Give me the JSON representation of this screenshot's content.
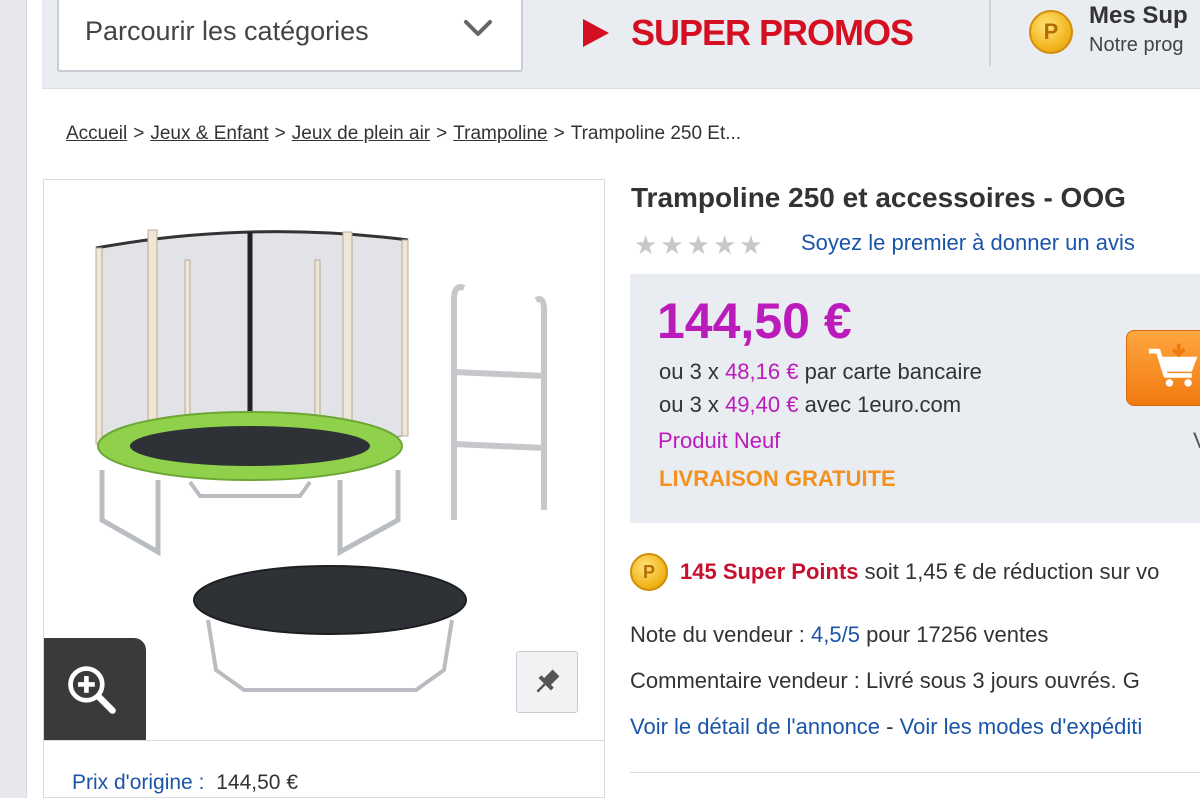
{
  "header": {
    "category_select": "Parcourir les catégories",
    "promo": "SUPER PROMOS",
    "coin_letter": "P",
    "mes_sup": "Mes Sup",
    "notre": "Notre prog"
  },
  "breadcrumb": {
    "items": [
      "Accueil",
      "Jeux & Enfant",
      "Jeux de plein air",
      "Trampoline"
    ],
    "current": "Trampoline 250 Et...",
    "separator": ">"
  },
  "product": {
    "title": "Trampoline 250 et accessoires - OOG",
    "rating_stars": 5,
    "rating_value": 0,
    "review_link": "Soyez le premier à donner un avis",
    "price": "144,50 €",
    "installment1": {
      "prefix": "ou 3 x",
      "amount": "48,16 €",
      "suffix": "par carte bancaire"
    },
    "installment2": {
      "prefix": "ou 3 x",
      "amount": "49,40 €",
      "suffix": "avec 1euro.com"
    },
    "condition": "Produit Neuf",
    "shipping": "LIVRAISON GRATUITE",
    "cart_side_letter": "V",
    "points": {
      "highlight": "145 Super Points",
      "rest": "soit 1,45 € de réduction sur vo"
    },
    "seller": {
      "prefix": "Note du vendeur :",
      "score": "4,5/5",
      "suffix": "pour 17256 ventes"
    },
    "comment": "Commentaire vendeur : Livré sous 3 jours ouvrés. G",
    "link1": "Voir le détail de l'annonce",
    "link_sep": "-",
    "link2": "Voir les modes d'expéditi",
    "origin_price_label": "Prix d'origine :",
    "origin_price_value": "144,50 €"
  },
  "colors": {
    "promo_red": "#d40f22",
    "price_magenta": "#bb1bbb",
    "link_blue": "#1a55a8",
    "shipping_orange": "#f3921e",
    "cart_orange": "#f07a10"
  },
  "icons": [
    "chevron-down-icon",
    "play-triangle-icon",
    "super-points-coin-icon",
    "star-icon",
    "zoom-in-icon",
    "pin-icon",
    "cart-add-icon"
  ]
}
